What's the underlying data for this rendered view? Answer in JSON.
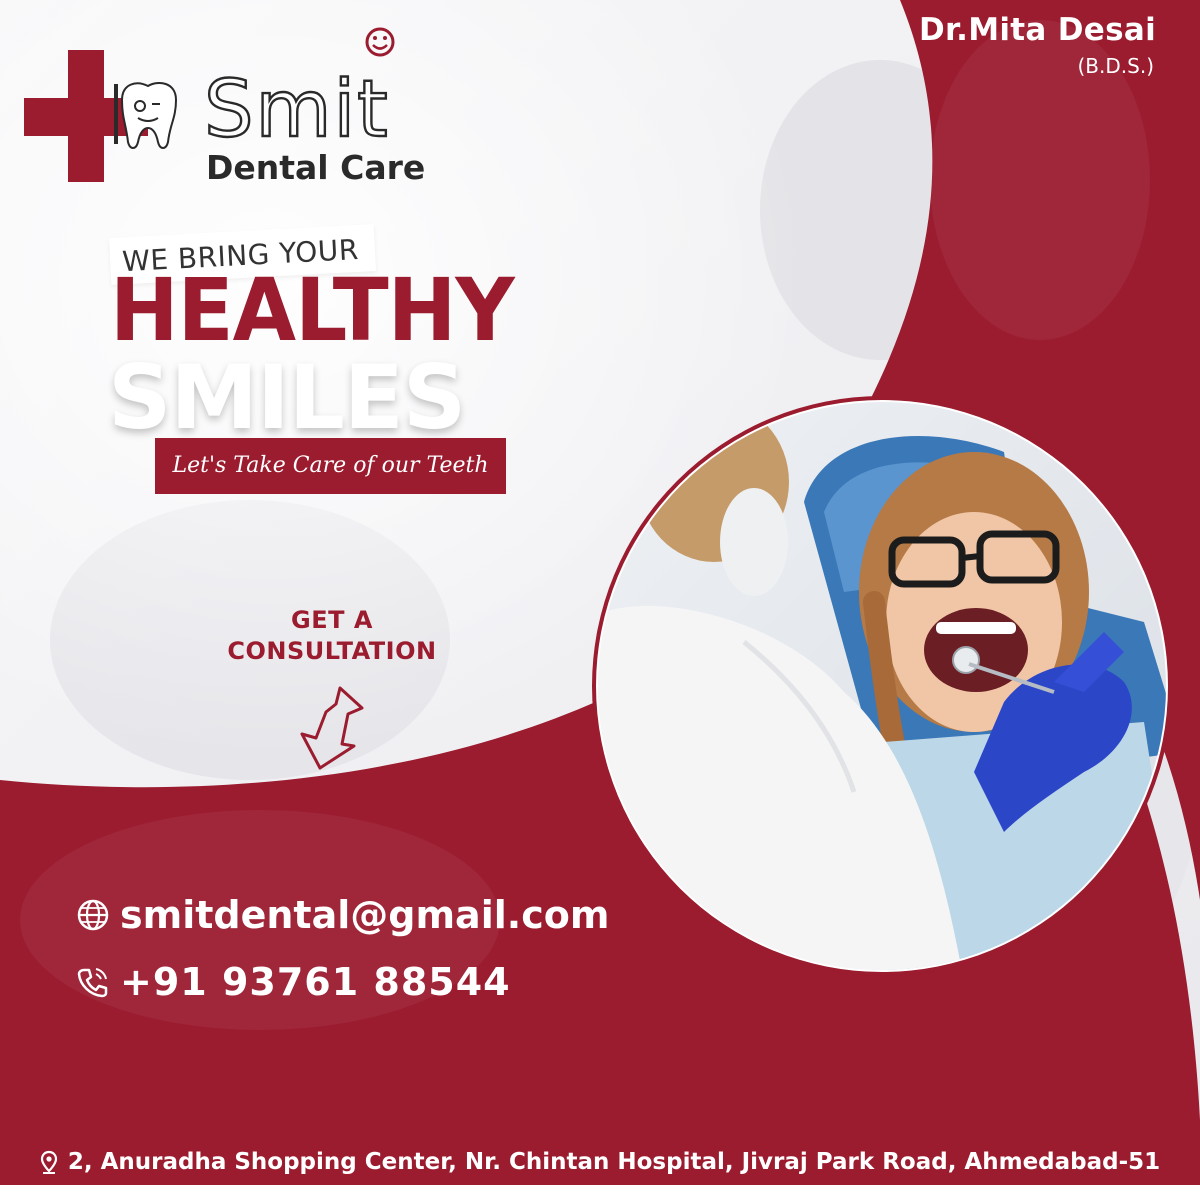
{
  "brand": {
    "name": "Smit",
    "subtitle": "Dental Care"
  },
  "doctor": {
    "name": "Dr.Mita Desai",
    "degree": "(B.D.S.)"
  },
  "headline": {
    "line1": "WE BRING YOUR",
    "line2": "HEALTHY",
    "line3": "SMILES",
    "script": "Let's Take Care of our Teeth"
  },
  "cta": {
    "text": "GET A CONSULTATION"
  },
  "contact": {
    "email": "smitdental@gmail.com",
    "phone": "+91 93761 88544"
  },
  "footer": {
    "address": "2, Anuradha Shopping Center, Nr. Chintan Hospital, Jivraj Park Road, Ahmedabad-51"
  },
  "colors": {
    "brand_red": "#9b1b2f",
    "text_dark": "#2a2a2a",
    "white": "#ffffff",
    "chair_blue": "#3a78b8",
    "glove_blue": "#2c46c8"
  }
}
